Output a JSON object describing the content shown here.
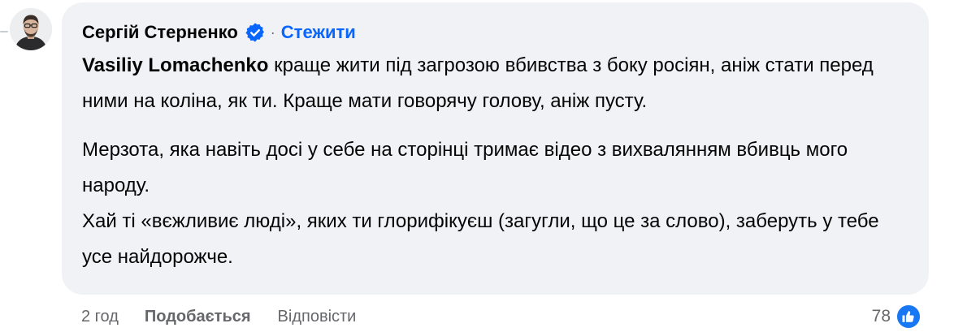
{
  "comment": {
    "author": "Сергій Стерненко",
    "separator": "·",
    "follow_label": "Стежити",
    "mention": "Vasiliy Lomachenko",
    "paragraph1_text": " краще жити під загрозою вбивства з боку росіян, аніж стати перед ними на коліна, як ти. Краще мати говорячу голову, аніж пусту.",
    "paragraph2_line1": "Мерзота, яка навіть досі у себе на сторінці тримає відео з вихвалянням вбивць мого народу.",
    "paragraph2_line2": "Хай ті «вєжливиє люді», яких ти глорифікуєш (загугли, що це за слово), заберуть у тебе усе найдорожче."
  },
  "actions": {
    "time": "2 год",
    "like_label": "Подобається",
    "reply_label": "Відповісти"
  },
  "reactions": {
    "count": "78",
    "icon": "thumbs-up-icon",
    "badge_color": "#1877f2"
  },
  "colors": {
    "bubble_bg": "#f0f2f5",
    "link_blue": "#0866ff",
    "secondary_text": "#65676b",
    "primary_text": "#050505"
  }
}
